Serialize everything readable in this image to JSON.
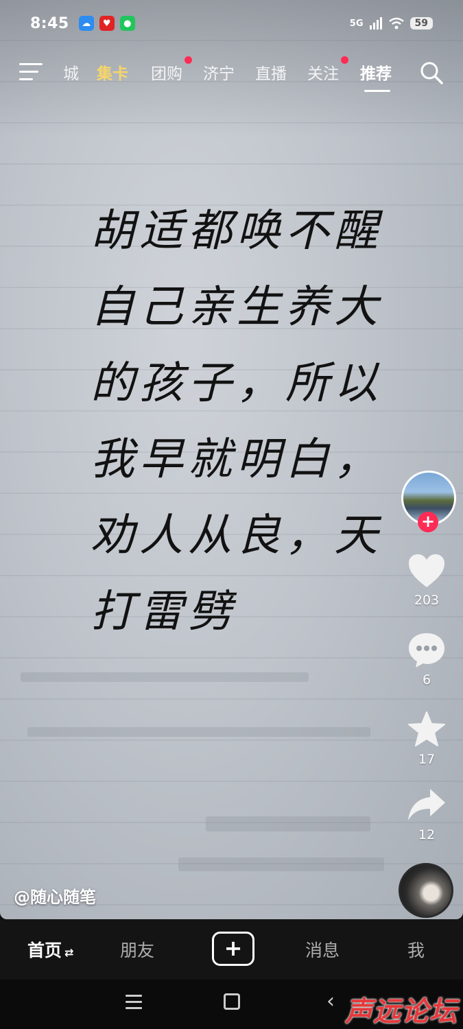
{
  "status_bar": {
    "time": "8:45",
    "network": "5G",
    "battery": "59",
    "app_icons": [
      "weather-app-icon",
      "health-app-icon",
      "chat-app-icon"
    ]
  },
  "top_nav": {
    "tabs": [
      {
        "label": "城",
        "badge": false
      },
      {
        "label": "集卡",
        "badge": false
      },
      {
        "label": "团购",
        "badge": true
      },
      {
        "label": "济宁",
        "badge": false
      },
      {
        "label": "直播",
        "badge": false
      },
      {
        "label": "关注",
        "badge": true
      },
      {
        "label": "推荐",
        "badge": false
      }
    ],
    "active_tab": "推荐",
    "highlight_tab": "集卡"
  },
  "video": {
    "calligraphy_lines": [
      "胡适都唤不醒",
      "自己亲生养大",
      "的孩子，所以",
      "我早就明白，",
      "劝人从良，天",
      "打雷劈"
    ],
    "author": "@随心随笔"
  },
  "actions": {
    "likes": "203",
    "comments": "6",
    "favorites": "17",
    "shares": "12"
  },
  "bottom_tabs": {
    "home": "首页",
    "friends": "朋友",
    "create": "+",
    "messages": "消息",
    "me": "我"
  },
  "watermark": "声远论坛",
  "colors": {
    "accent": "#fe2c55",
    "gold_tab": "#f6d56a",
    "tab_bar_bg": "#141414"
  }
}
